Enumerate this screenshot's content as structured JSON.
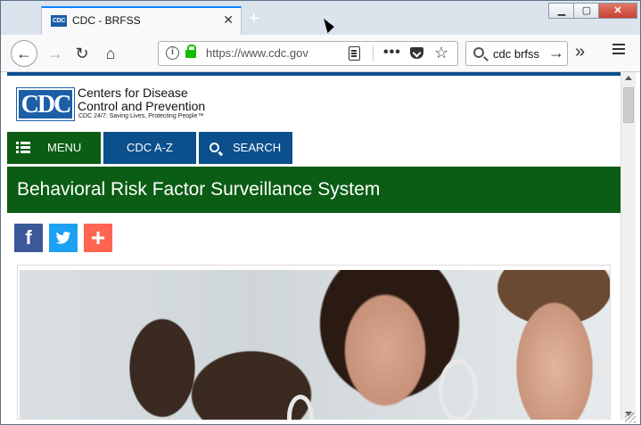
{
  "browser": {
    "tab_title": "CDC - BRFSS",
    "tab_favicon_text": "CDC",
    "url": "https://www.cdc.gov",
    "search_text": "cdc brfss"
  },
  "page": {
    "logo_text": "CDC",
    "org_name_line1": "Centers for Disease",
    "org_name_line2": "Control and Prevention",
    "tagline": "CDC 24/7: Saving Lives, Protecting People™",
    "menu_label": "MENU",
    "az_label": "CDC A-Z",
    "search_label": "SEARCH",
    "banner_title": "Behavioral Risk Factor Surveillance System",
    "social": {
      "facebook": "f",
      "plus": "+"
    }
  },
  "colors": {
    "cdc_blue": "#0b4f8c",
    "cdc_green": "#0b5c14",
    "facebook": "#3b5998",
    "twitter": "#1da1f2",
    "addthis": "#ff6550"
  }
}
